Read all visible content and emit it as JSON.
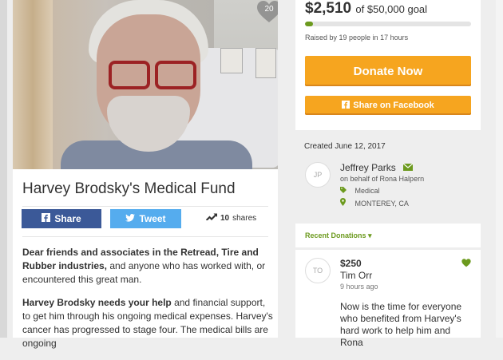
{
  "photo": {
    "like_count": "20"
  },
  "campaign": {
    "title": "Harvey Brodsky's Medical Fund",
    "share_label": "Share",
    "tweet_label": "Tweet",
    "shares_count": "10",
    "shares_label": "shares",
    "paragraph1_bold": "Dear friends and associates in the Retread, Tire and Rubber industries,",
    "paragraph1_rest": " and anyone who has worked with, or encountered this great man.",
    "paragraph2_bold": "Harvey Brodsky needs your help",
    "paragraph2_rest": " and financial support, to get him through his ongoing medical expenses. Harvey's cancer has progressed to stage four. The medical bills are ongoing"
  },
  "donation_box": {
    "amount": "$2,510",
    "goal_text": "of $50,000 goal",
    "progress_fraction": 0.0502,
    "raised_text": "Raised by 19 people in 17 hours",
    "donate_label": "Donate Now",
    "facebook_label": "Share on Facebook"
  },
  "organizer": {
    "created": "Created June 12, 2017",
    "initials": "JP",
    "name": "Jeffrey Parks",
    "behalf": "on behalf of Rona Halpern",
    "category": "Medical",
    "location": "MONTEREY, CA"
  },
  "recent": {
    "label": "Recent Donations"
  },
  "donation": {
    "initials": "TO",
    "amount": "$250",
    "name": "Tim Orr",
    "time": "9 hours ago",
    "message": "Now is the time for everyone who benefited from Harvey's hard work to help him and Rona"
  },
  "colors": {
    "accent_orange": "#f6a51f",
    "accent_green": "#6c9a1e",
    "facebook_blue": "#3b5998",
    "twitter_blue": "#55acee"
  }
}
